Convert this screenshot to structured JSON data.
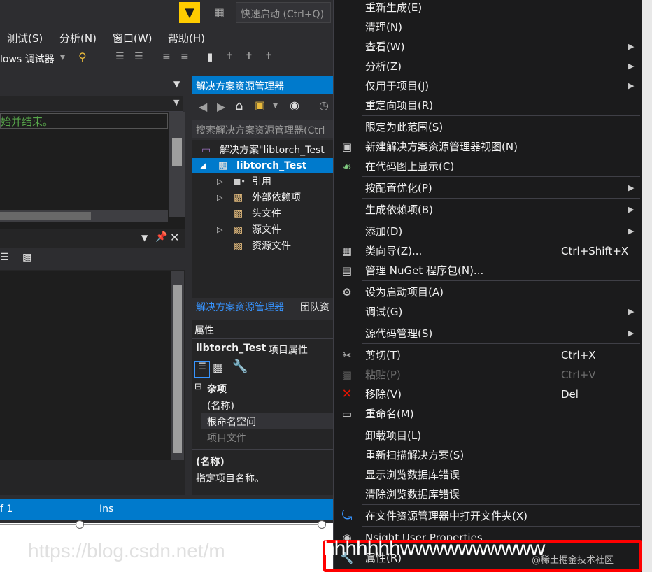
{
  "quick_launch": {
    "placeholder": "快速启动 (Ctrl+Q)"
  },
  "menubar": {
    "items": [
      "测试(S)",
      "分析(N)",
      "窗口(W)",
      "帮助(H)"
    ]
  },
  "toolbar": {
    "debugger_label": "lows 调试器"
  },
  "output": {
    "line": "始并结束。"
  },
  "solution_explorer": {
    "title": "解决方案资源管理器",
    "search_placeholder": "搜索解决方案资源管理器(Ctrl",
    "tree": [
      {
        "label": "解决方案\"libtorch_Test"
      },
      {
        "label": "libtorch_Test"
      },
      {
        "label": "引用"
      },
      {
        "label": "外部依赖项"
      },
      {
        "label": "头文件"
      },
      {
        "label": "源文件"
      },
      {
        "label": "资源文件"
      }
    ],
    "tabs": [
      "解决方案资源管理器",
      "团队资"
    ]
  },
  "properties": {
    "title": "属性",
    "subject": "libtorch_Test",
    "subject_suffix": "项目属性",
    "category": "杂项",
    "rows": [
      "(名称)",
      "根命名空间",
      "项目文件"
    ],
    "desc_title": "(名称)",
    "desc_text": "指定项目名称。"
  },
  "statusbar": {
    "left": "f 1",
    "mode": "Ins"
  },
  "context_menu": {
    "items": [
      {
        "label": "重新生成(E)"
      },
      {
        "label": "清理(N)"
      },
      {
        "label": "查看(W)",
        "submenu": true
      },
      {
        "label": "分析(Z)",
        "submenu": true
      },
      {
        "label": "仅用于项目(J)",
        "submenu": true
      },
      {
        "label": "重定向项目(R)"
      },
      {
        "label": "限定为此范围(S)"
      },
      {
        "label": "新建解决方案资源管理器视图(N)",
        "icon": "new-view-icon"
      },
      {
        "label": "在代码图上显示(C)",
        "icon": "code-map-icon"
      },
      {
        "label": "按配置优化(P)",
        "submenu": true
      },
      {
        "label": "生成依赖项(B)",
        "submenu": true
      },
      {
        "label": "添加(D)",
        "submenu": true
      },
      {
        "label": "类向导(Z)...",
        "shortcut": "Ctrl+Shift+X",
        "icon": "class-wizard-icon"
      },
      {
        "label": "管理 NuGet 程序包(N)...",
        "icon": "nuget-icon"
      },
      {
        "label": "设为启动项目(A)",
        "icon": "gear-icon"
      },
      {
        "label": "调试(G)",
        "submenu": true
      },
      {
        "label": "源代码管理(S)",
        "submenu": true
      },
      {
        "label": "剪切(T)",
        "shortcut": "Ctrl+X",
        "icon": "scissors-icon"
      },
      {
        "label": "粘贴(P)",
        "shortcut": "Ctrl+V",
        "icon": "paste-icon",
        "disabled": true
      },
      {
        "label": "移除(V)",
        "shortcut": "Del",
        "icon": "remove-icon"
      },
      {
        "label": "重命名(M)",
        "icon": "rename-icon"
      },
      {
        "label": "卸载项目(L)"
      },
      {
        "label": "重新扫描解决方案(S)"
      },
      {
        "label": "显示浏览数据库错误"
      },
      {
        "label": "清除浏览数据库错误"
      },
      {
        "label": "在文件资源管理器中打开文件夹(X)",
        "icon": "open-folder-icon"
      },
      {
        "label": "Nsight User Properties",
        "icon": "nsight-icon"
      },
      {
        "label": "属性(R)"
      }
    ]
  },
  "annotation": {
    "scribble": "hhhhhhhwwwwwwwwww"
  },
  "watermark": {
    "url": "https://blog.csdn.net/m",
    "site": "@稀土掘金技术社区"
  },
  "colors": {
    "accent": "#007acc",
    "highlight": "#ff0000",
    "filter": "#ffcc00"
  }
}
